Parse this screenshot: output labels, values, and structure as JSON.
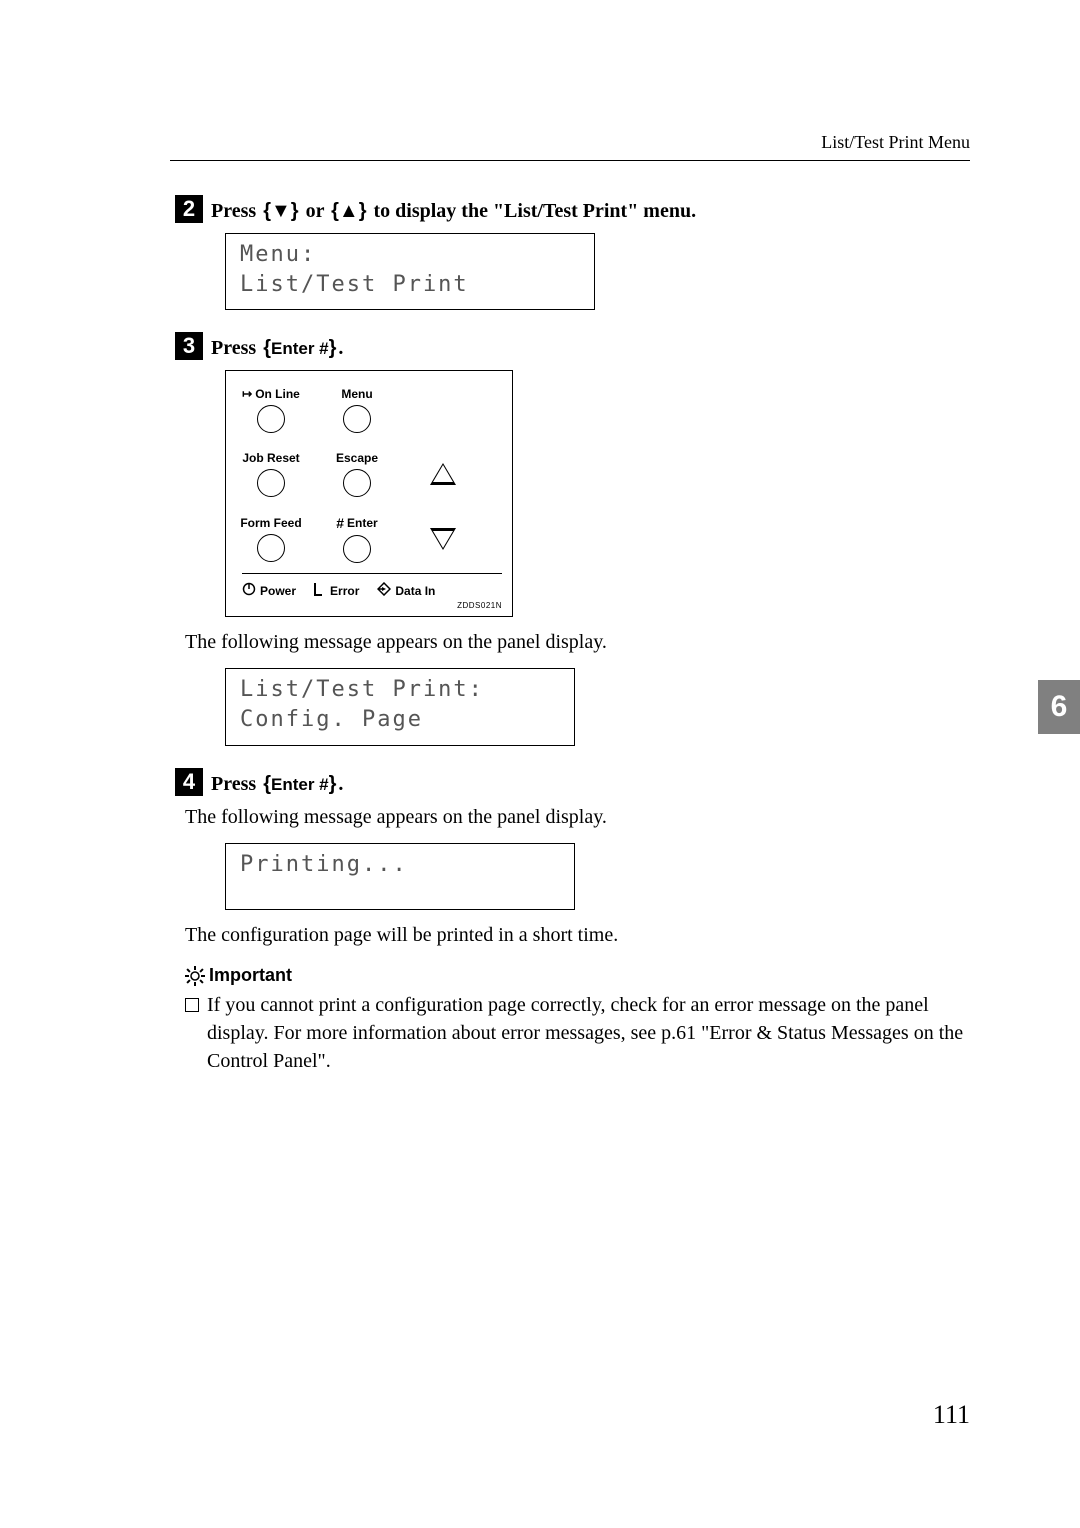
{
  "header": {
    "section": "List/Test Print Menu"
  },
  "chapter_tab": "6",
  "page_number": "111",
  "steps": {
    "s2": {
      "num": "2",
      "pre": "Press",
      "mid": "or",
      "post": "to display the \"List/Test Print\" menu.",
      "lcd_line1": "Menu:",
      "lcd_line2": " List/Test Print"
    },
    "s3": {
      "num": "3",
      "pre": "Press",
      "key": "Enter #",
      "post": ".",
      "panel": {
        "online": "On Line",
        "jobreset": "Job Reset",
        "formfeed": "Form Feed",
        "menu": "Menu",
        "escape": "Escape",
        "enter": "Enter",
        "power": "Power",
        "error": "Error",
        "datain": "Data In",
        "ref": "ZDDS021N"
      },
      "after_panel_text": "The following message appears on the panel display.",
      "lcd_line1": "List/Test Print:",
      "lcd_line2": " Config. Page"
    },
    "s4": {
      "num": "4",
      "pre": "Press",
      "key": "Enter #",
      "post": ".",
      "after_text": "The following message appears on the panel display.",
      "lcd_line1": "Printing...",
      "after_lcd_text": "The configuration page will be printed in a short time."
    }
  },
  "important": {
    "heading": "Important",
    "bullet": "If you cannot print a configuration page correctly, check for an error message on the panel display. For more information about error messages, see p.61 \"Error & Status Messages on the Control Panel\"."
  }
}
